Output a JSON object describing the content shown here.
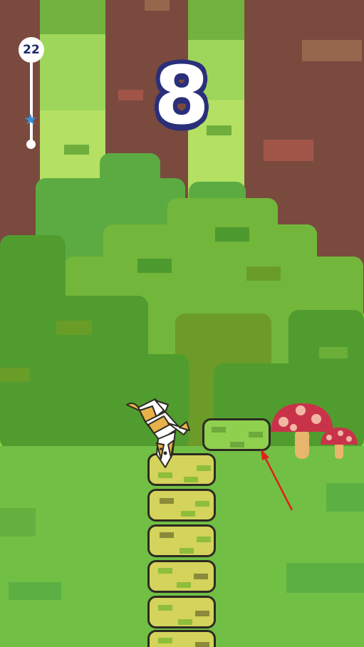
{
  "hud": {
    "score": "8",
    "level": "22",
    "progress_star": "★",
    "level_progress": 0.35
  },
  "colors": {
    "score_outline": "#2a2f7a",
    "progress_star": "#3b8fd8",
    "tree_trunk": "#7a4a3f",
    "ground": "#71bf44",
    "block": "#d4d35b",
    "next_block": "#8fd14f",
    "mushroom_cap": "#c8334a",
    "pointer_arrow": "#e0201c"
  },
  "icons": {
    "player": "shiba-dog-icon",
    "mushroom": "mushroom-icon",
    "arrow": "pointer-arrow-icon",
    "star": "star-icon"
  },
  "tower": {
    "stacked_blocks": 6
  }
}
